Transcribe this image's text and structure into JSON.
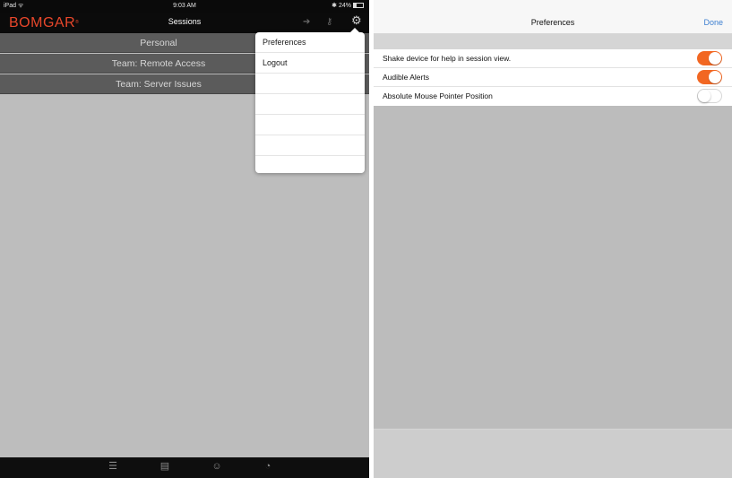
{
  "left": {
    "status": {
      "carrier": "iPad ᯤ",
      "time": "9:03 AM",
      "battery": "✱ 24%"
    },
    "navbar": {
      "logo": "BOMGAR",
      "title": "Sessions"
    },
    "teams": [
      "Personal",
      "Team: Remote Access",
      "Team: Server Issues"
    ],
    "menu": {
      "items": [
        "Preferences",
        "Logout"
      ]
    }
  },
  "right": {
    "navbar": {
      "title": "Preferences",
      "done_label": "Done"
    },
    "preferences": [
      {
        "label": "Shake device for help in session view.",
        "on": true
      },
      {
        "label": "Audible Alerts",
        "on": true
      },
      {
        "label": "Absolute Mouse Pointer Position",
        "on": false
      }
    ]
  },
  "colors": {
    "accent": "#f26722",
    "logo": "#e8472b",
    "link": "#3d7fd0"
  }
}
